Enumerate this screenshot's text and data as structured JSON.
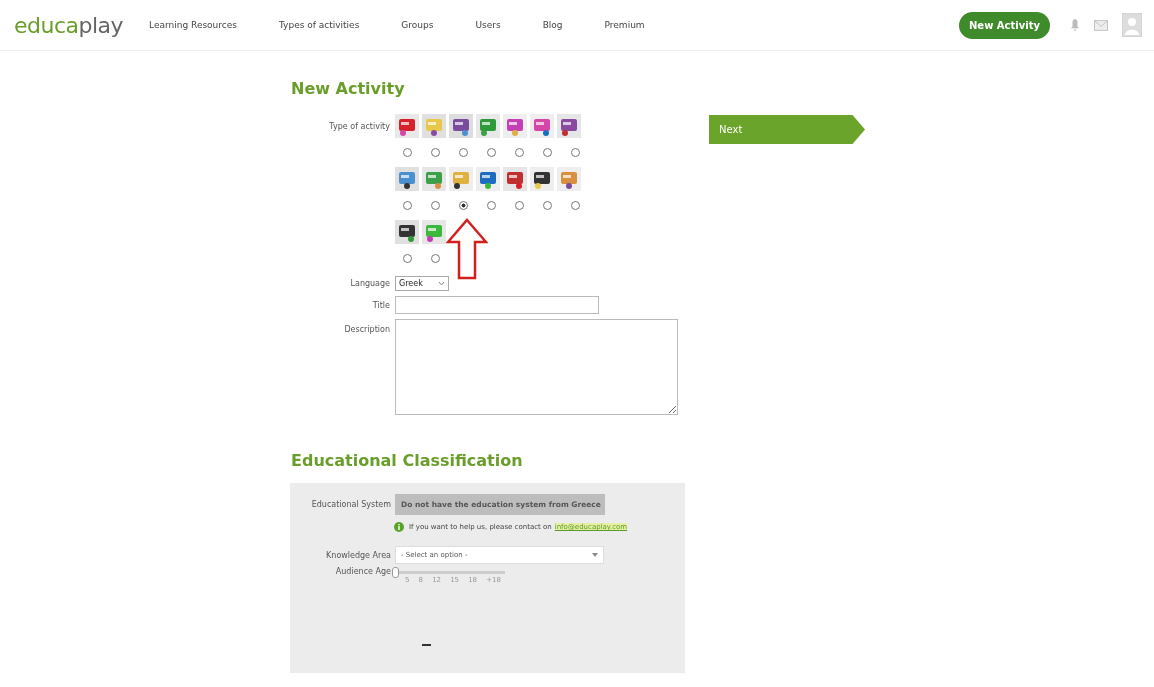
{
  "nav": {
    "logo": {
      "accent": "educa",
      "rest": "play"
    },
    "links": [
      "Learning Resources",
      "Types of activities",
      "Groups",
      "Users",
      "Blog",
      "Premium"
    ],
    "new_activity": "New Activity"
  },
  "form": {
    "heading": "New Activity",
    "type_label": "Type of activity",
    "activities": [
      {
        "selected": false
      },
      {
        "selected": false
      },
      {
        "selected": false
      },
      {
        "selected": false
      },
      {
        "selected": false
      },
      {
        "selected": false
      },
      {
        "selected": false
      },
      {
        "selected": false
      },
      {
        "selected": false
      },
      {
        "selected": true
      },
      {
        "selected": false
      },
      {
        "selected": false
      },
      {
        "selected": false
      },
      {
        "selected": false
      },
      {
        "selected": false
      },
      {
        "selected": false
      }
    ],
    "language_label": "Language",
    "language": "Greek",
    "title_label": "Title",
    "description_label": "Description",
    "next": "Next"
  },
  "classification": {
    "heading": "Educational Classification",
    "system_label": "Educational System",
    "system_value": "Do not have the education system from Greece",
    "help_text": "If you want to help us, please contact on",
    "help_link": "info@educaplay.com",
    "knowledge_label": "Knowledge Area",
    "knowledge_placeholder": "- Select an option -",
    "age_label": "Audience Age",
    "age_slider": {
      "level": 0
    },
    "age_ticks": [
      "5",
      "8",
      "12",
      "15",
      "18",
      "+18"
    ]
  }
}
